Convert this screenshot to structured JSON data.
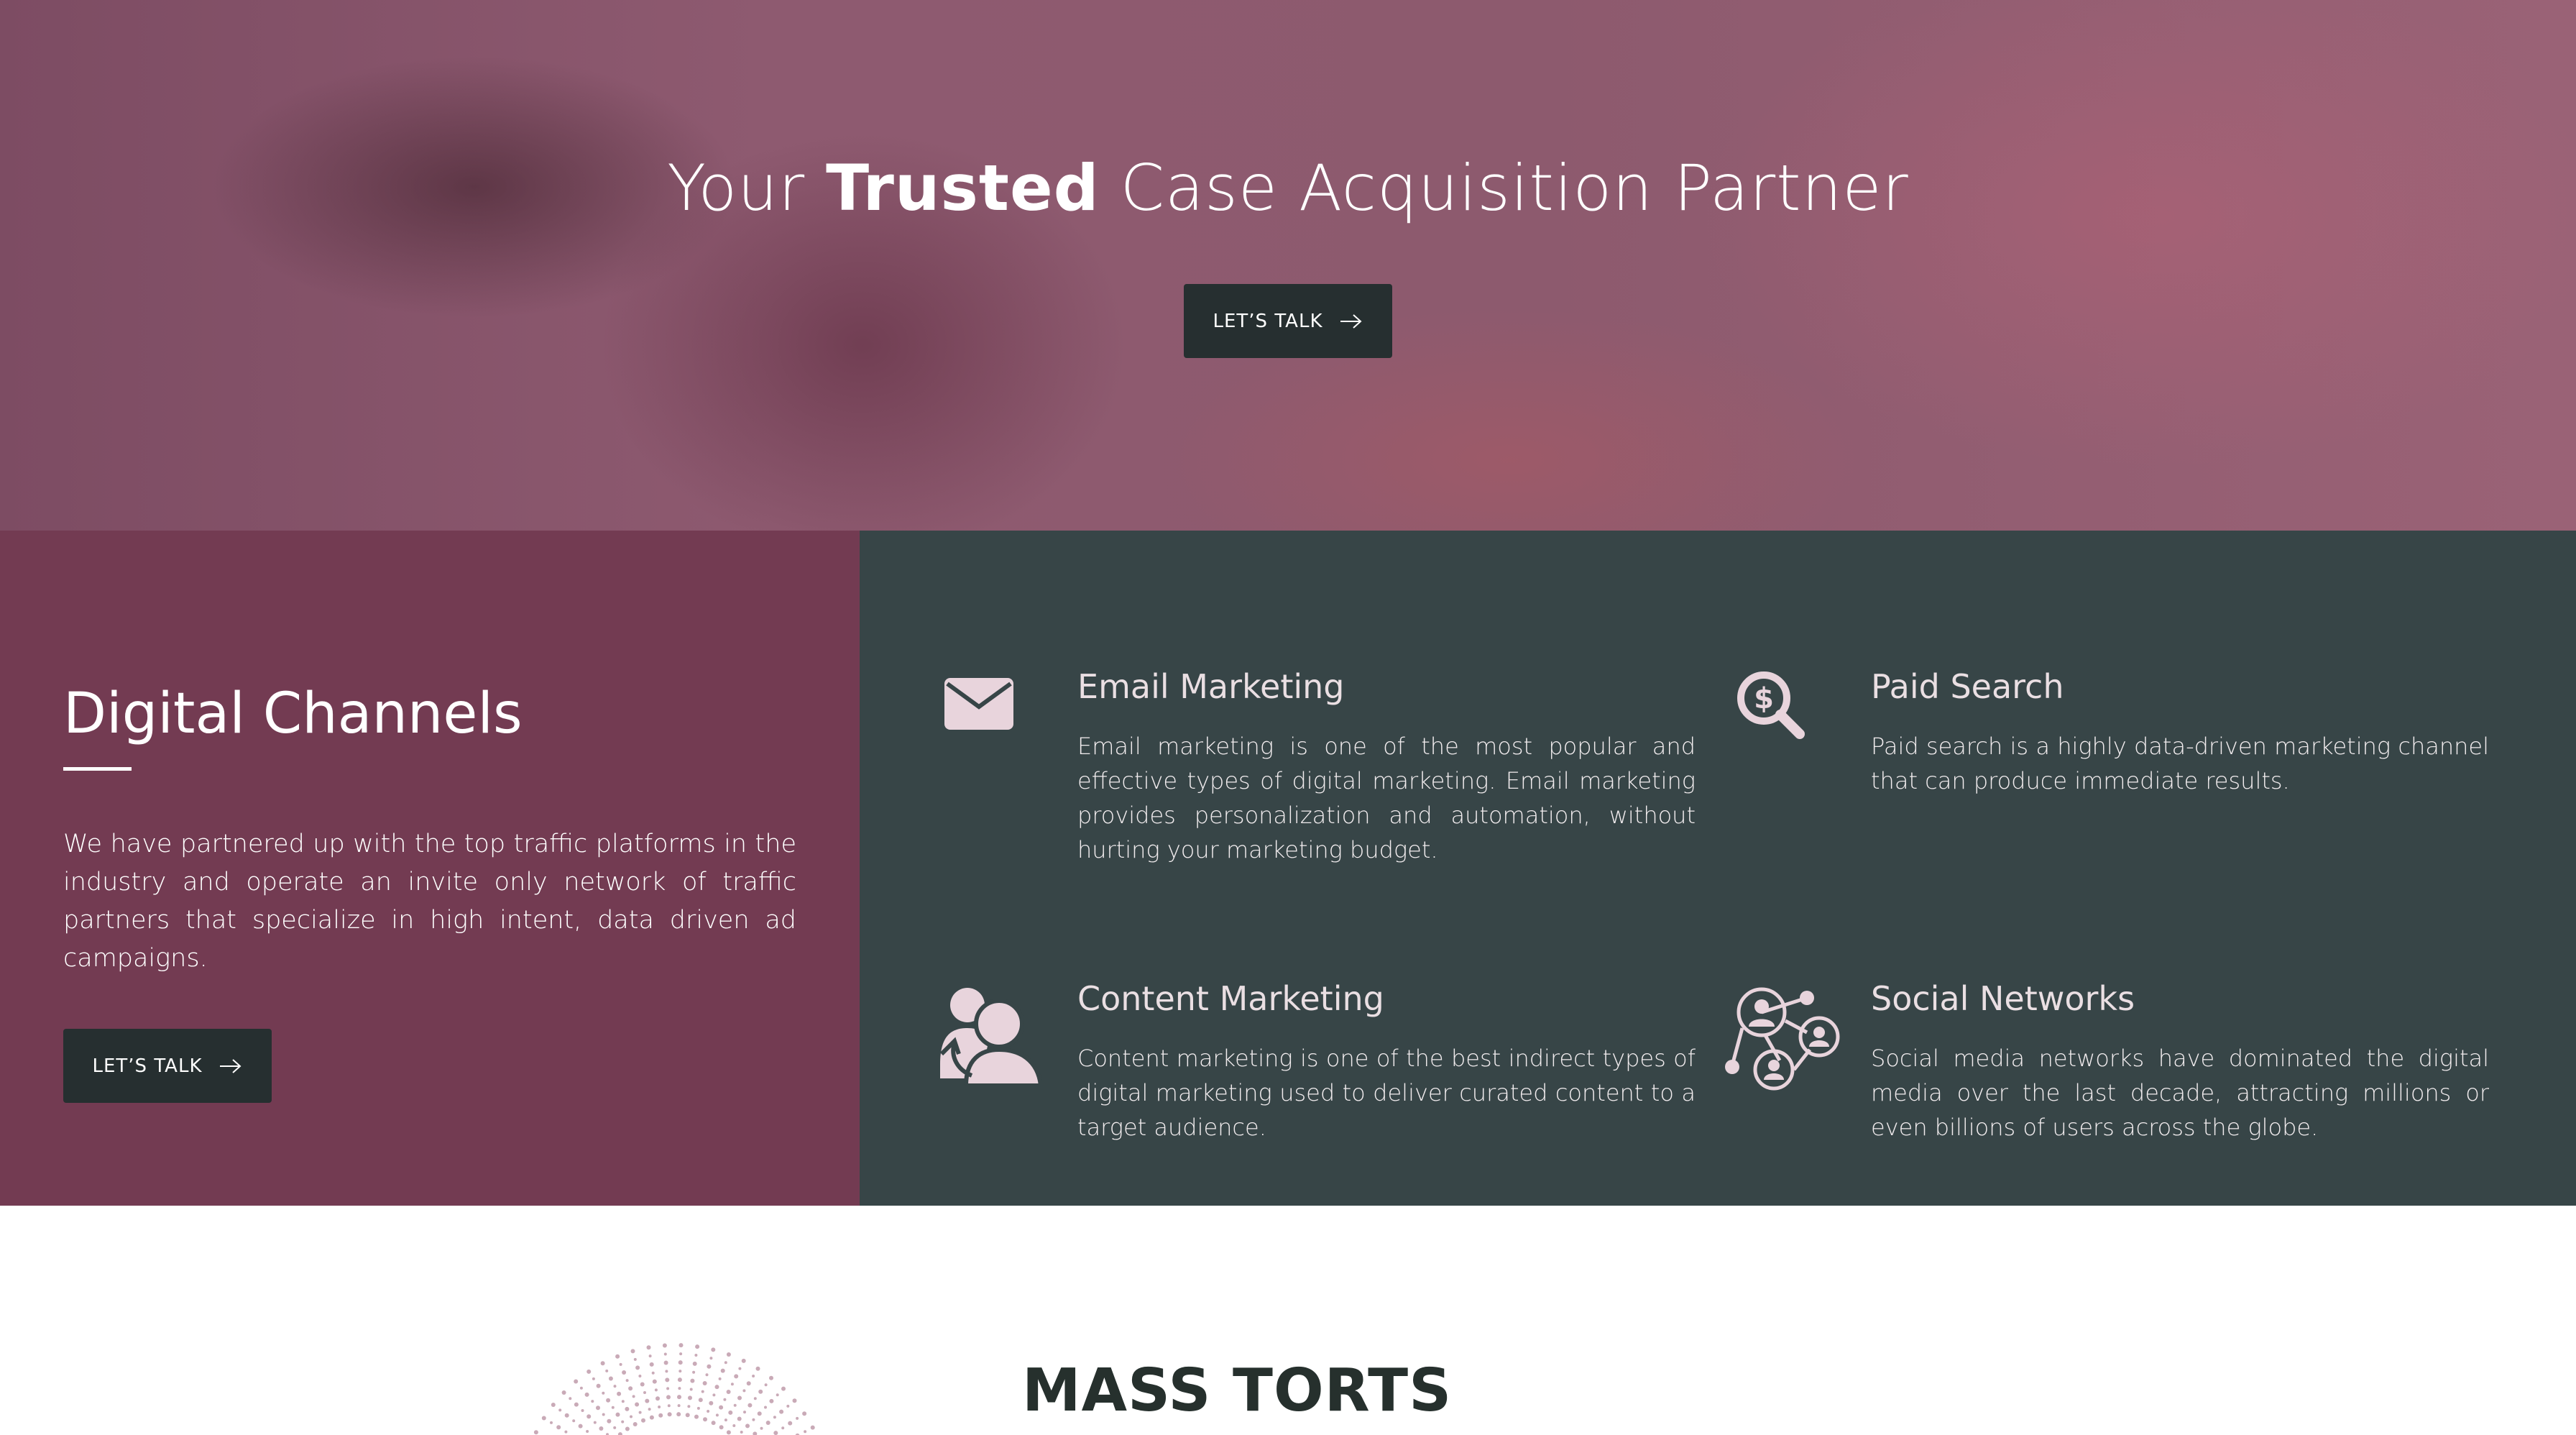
{
  "hero": {
    "title_pre": "Your ",
    "title_bold": "Trusted",
    "title_post": " Case Acquisition Partner",
    "button_label": "LET’S TALK"
  },
  "digital_channels": {
    "title": "Digital Channels",
    "description": "We have partnered up with the top traffic platforms in the industry and operate an invite only network of traffic partners that specialize in high intent, data driven ad campaigns.",
    "button_label": "LET’S TALK"
  },
  "services": [
    {
      "icon": "envelope-icon",
      "title": "Email Marketing",
      "text": "Email marketing is one of the most popular and effective types of digital marketing. Email marketing provides personalization and automation, without hurting your marketing budget."
    },
    {
      "icon": "dollar-search-icon",
      "title": "Paid Search",
      "text": "Paid search is a highly data-driven marketing channel that can produce immediate results."
    },
    {
      "icon": "users-content-icon",
      "title": "Content Marketing",
      "text": "Content marketing is one of the best indirect types of digital marketing used to deliver curated content to a target audience."
    },
    {
      "icon": "social-network-icon",
      "title": "Social Networks",
      "text": "Social media networks have dominated the digital media over the last decade, attracting millions or even billions of users across the globe."
    }
  ],
  "mass_torts": {
    "title": "MASS TORTS"
  },
  "colors": {
    "hero_overlay": "#8e5a70",
    "left_panel": "#733b52",
    "right_panel": "#374547",
    "button": "#262f30",
    "icon": "#e8d4dc"
  }
}
